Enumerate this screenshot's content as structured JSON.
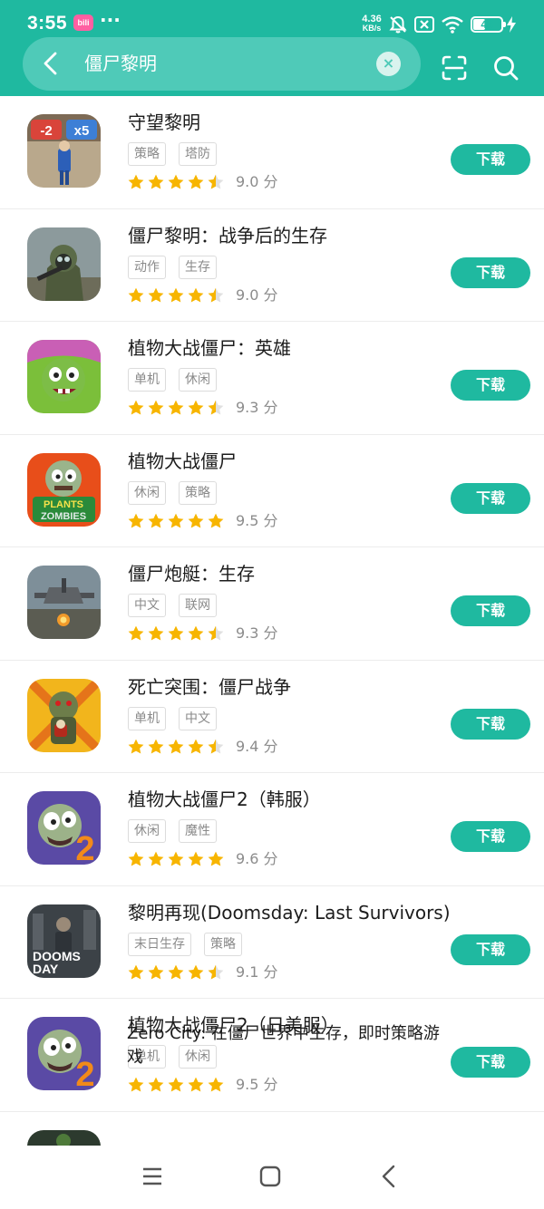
{
  "status_bar": {
    "time": "3:55",
    "app_badge": "bili",
    "more": "···",
    "net_speed_value": "4.36",
    "net_speed_unit": "KB/s",
    "battery": "48",
    "battery_fraction": 0.48
  },
  "search": {
    "query": "僵尸黎明"
  },
  "download_label": "下载",
  "apps": [
    {
      "name": "守望黎明",
      "tags": [
        "策略",
        "塔防"
      ],
      "rating": 4.5,
      "score": "9.0 分",
      "icon": "watch-dawn-icon"
    },
    {
      "name": "僵尸黎明：战争后的生存",
      "tags": [
        "动作",
        "生存"
      ],
      "rating": 4.5,
      "score": "9.0 分",
      "icon": "soldier-gasmask-icon"
    },
    {
      "name": "植物大战僵尸：英雄",
      "tags": [
        "单机",
        "休闲"
      ],
      "rating": 4.5,
      "score": "9.3 分",
      "icon": "pvz-heroes-icon"
    },
    {
      "name": "植物大战僵尸",
      "tags": [
        "休闲",
        "策略"
      ],
      "rating": 5,
      "score": "9.5 分",
      "icon": "pvz-icon"
    },
    {
      "name": "僵尸炮艇：生存",
      "tags": [
        "中文",
        "联网"
      ],
      "rating": 4.5,
      "score": "9.3 分",
      "icon": "gunship-icon"
    },
    {
      "name": "死亡突围：僵尸战争",
      "tags": [
        "单机",
        "中文"
      ],
      "rating": 4.5,
      "score": "9.4 分",
      "icon": "dead-ahead-icon"
    },
    {
      "name": "植物大战僵尸2（韩服）",
      "tags": [
        "休闲",
        "魔性"
      ],
      "rating": 5,
      "score": "9.6 分",
      "icon": "pvz2-icon"
    },
    {
      "name": "黎明再现(Doomsday: Last Survivors)",
      "tags": [
        "末日生存",
        "策略"
      ],
      "rating": 4.5,
      "score": "9.1 分",
      "icon": "doomsday-icon"
    },
    {
      "name": "植物大战僵尸2（日美服）",
      "tags": [
        "单机",
        "休闲"
      ],
      "rating": 5,
      "score": "9.5 分",
      "icon": "pvz2-icon"
    }
  ],
  "partial_app": {
    "name": "Zero City: 在僵尸世界中生存，即时策略游戏"
  },
  "colors": {
    "brand": "#1fb9a0",
    "star": "#f7b500",
    "star_empty": "#e0e0e0"
  }
}
